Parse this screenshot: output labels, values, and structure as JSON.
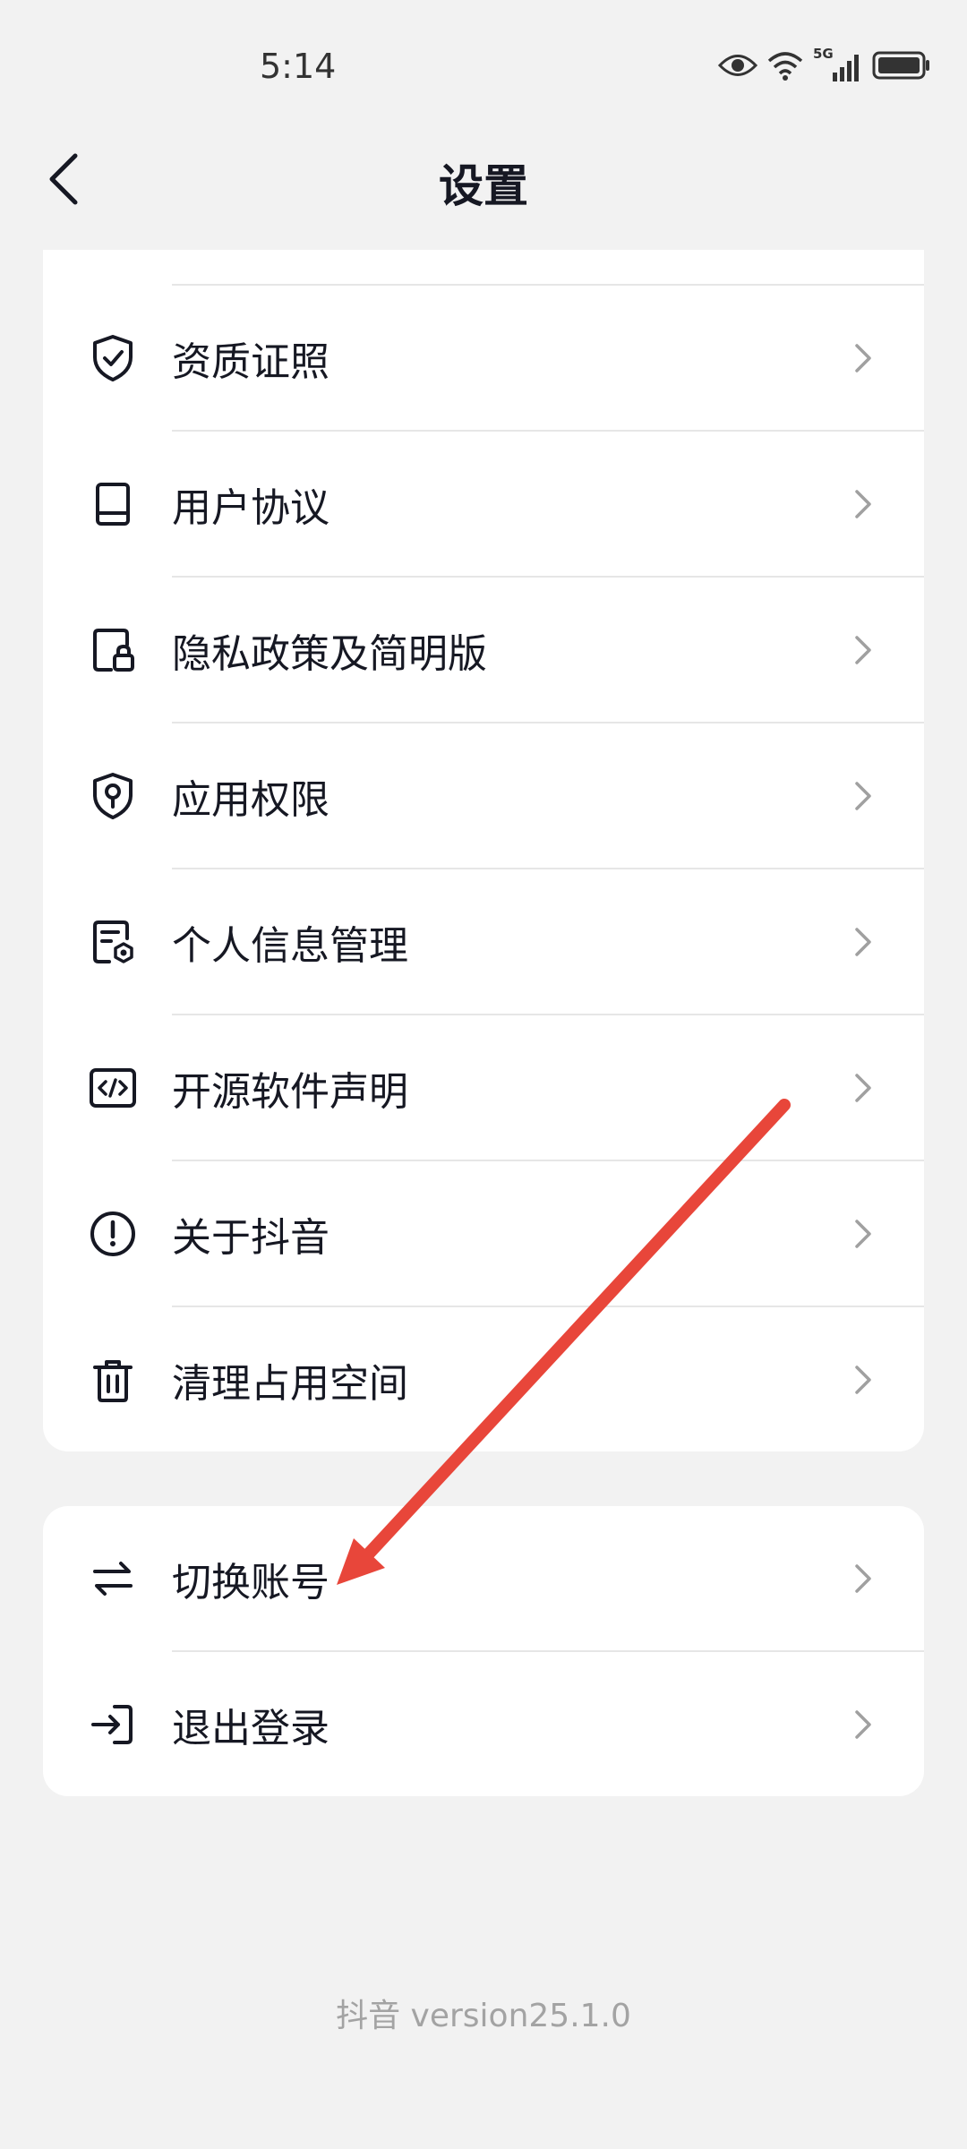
{
  "status_bar": {
    "time": "5:14",
    "network": "5G"
  },
  "header": {
    "title": "设置",
    "back_icon": "chevron-left-icon"
  },
  "settings_items": [
    {
      "label": "资质证照",
      "icon": "shield-check-icon"
    },
    {
      "label": "用户协议",
      "icon": "book-icon"
    },
    {
      "label": "隐私政策及简明版",
      "icon": "document-lock-icon"
    },
    {
      "label": "应用权限",
      "icon": "shield-key-icon"
    },
    {
      "label": "个人信息管理",
      "icon": "document-gear-icon"
    },
    {
      "label": "开源软件声明",
      "icon": "code-icon"
    },
    {
      "label": "关于抖音",
      "icon": "info-circle-icon"
    },
    {
      "label": "清理占用空间",
      "icon": "trash-icon"
    }
  ],
  "account_items": [
    {
      "label": "切换账号",
      "icon": "switch-arrows-icon"
    },
    {
      "label": "退出登录",
      "icon": "logout-icon"
    }
  ],
  "footer": {
    "version": "抖音 version25.1.0"
  },
  "colors": {
    "background": "#f2f2f2",
    "card": "#ffffff",
    "text": "#161823",
    "divider": "#e6e6e6",
    "chevron": "#a0a0a0",
    "annotation_arrow": "#e8463a"
  }
}
